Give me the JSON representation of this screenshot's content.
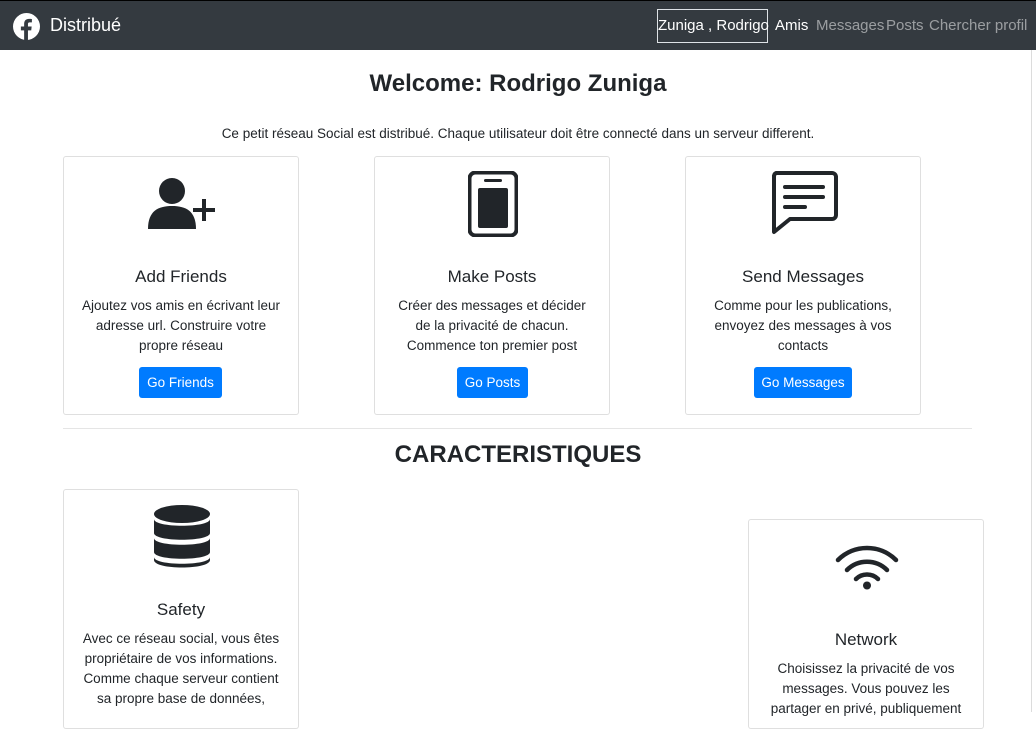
{
  "navbar": {
    "brand": "Distribué",
    "brand_icon": "facebook-icon",
    "user": "Zuniga , Rodrigo",
    "links": [
      "Amis",
      "Messages",
      "Posts",
      "Chercher profil"
    ],
    "bg_color": "#343a40"
  },
  "main": {
    "welcome": "Welcome: Rodrigo Zuniga",
    "intro": "Ce petit réseau Social est distribué. Chaque utilisateur doit être connecté dans un serveur different.",
    "cards": [
      {
        "icon": "add-user-icon",
        "title": "Add Friends",
        "text": "Ajoutez vos amis en écrivant leur adresse url. Construire votre propre réseau",
        "button": "Go Friends"
      },
      {
        "icon": "tablet-icon",
        "title": "Make Posts",
        "text": "Créer des messages et décider de la privacité de chacun. Commence ton premier post",
        "button": "Go Posts"
      },
      {
        "icon": "chat-icon",
        "title": "Send Messages",
        "text": "Comme pour les publications, envoyez des messages à vos contacts",
        "button": "Go Messages"
      }
    ]
  },
  "features": {
    "title": "CARACTERISTIQUES",
    "cards": [
      {
        "icon": "database-icon",
        "title": "Safety",
        "text": "Avec ce réseau social, vous êtes propriétaire de vos informations. Comme chaque serveur contient sa propre base de données,"
      },
      {
        "icon": "wifi-icon",
        "title": "Network",
        "text": "Choisissez la privacité de vos messages. Vous pouvez les partager en privé, publiquement"
      }
    ]
  },
  "colors": {
    "primary": "#007bff",
    "text": "#212529"
  }
}
